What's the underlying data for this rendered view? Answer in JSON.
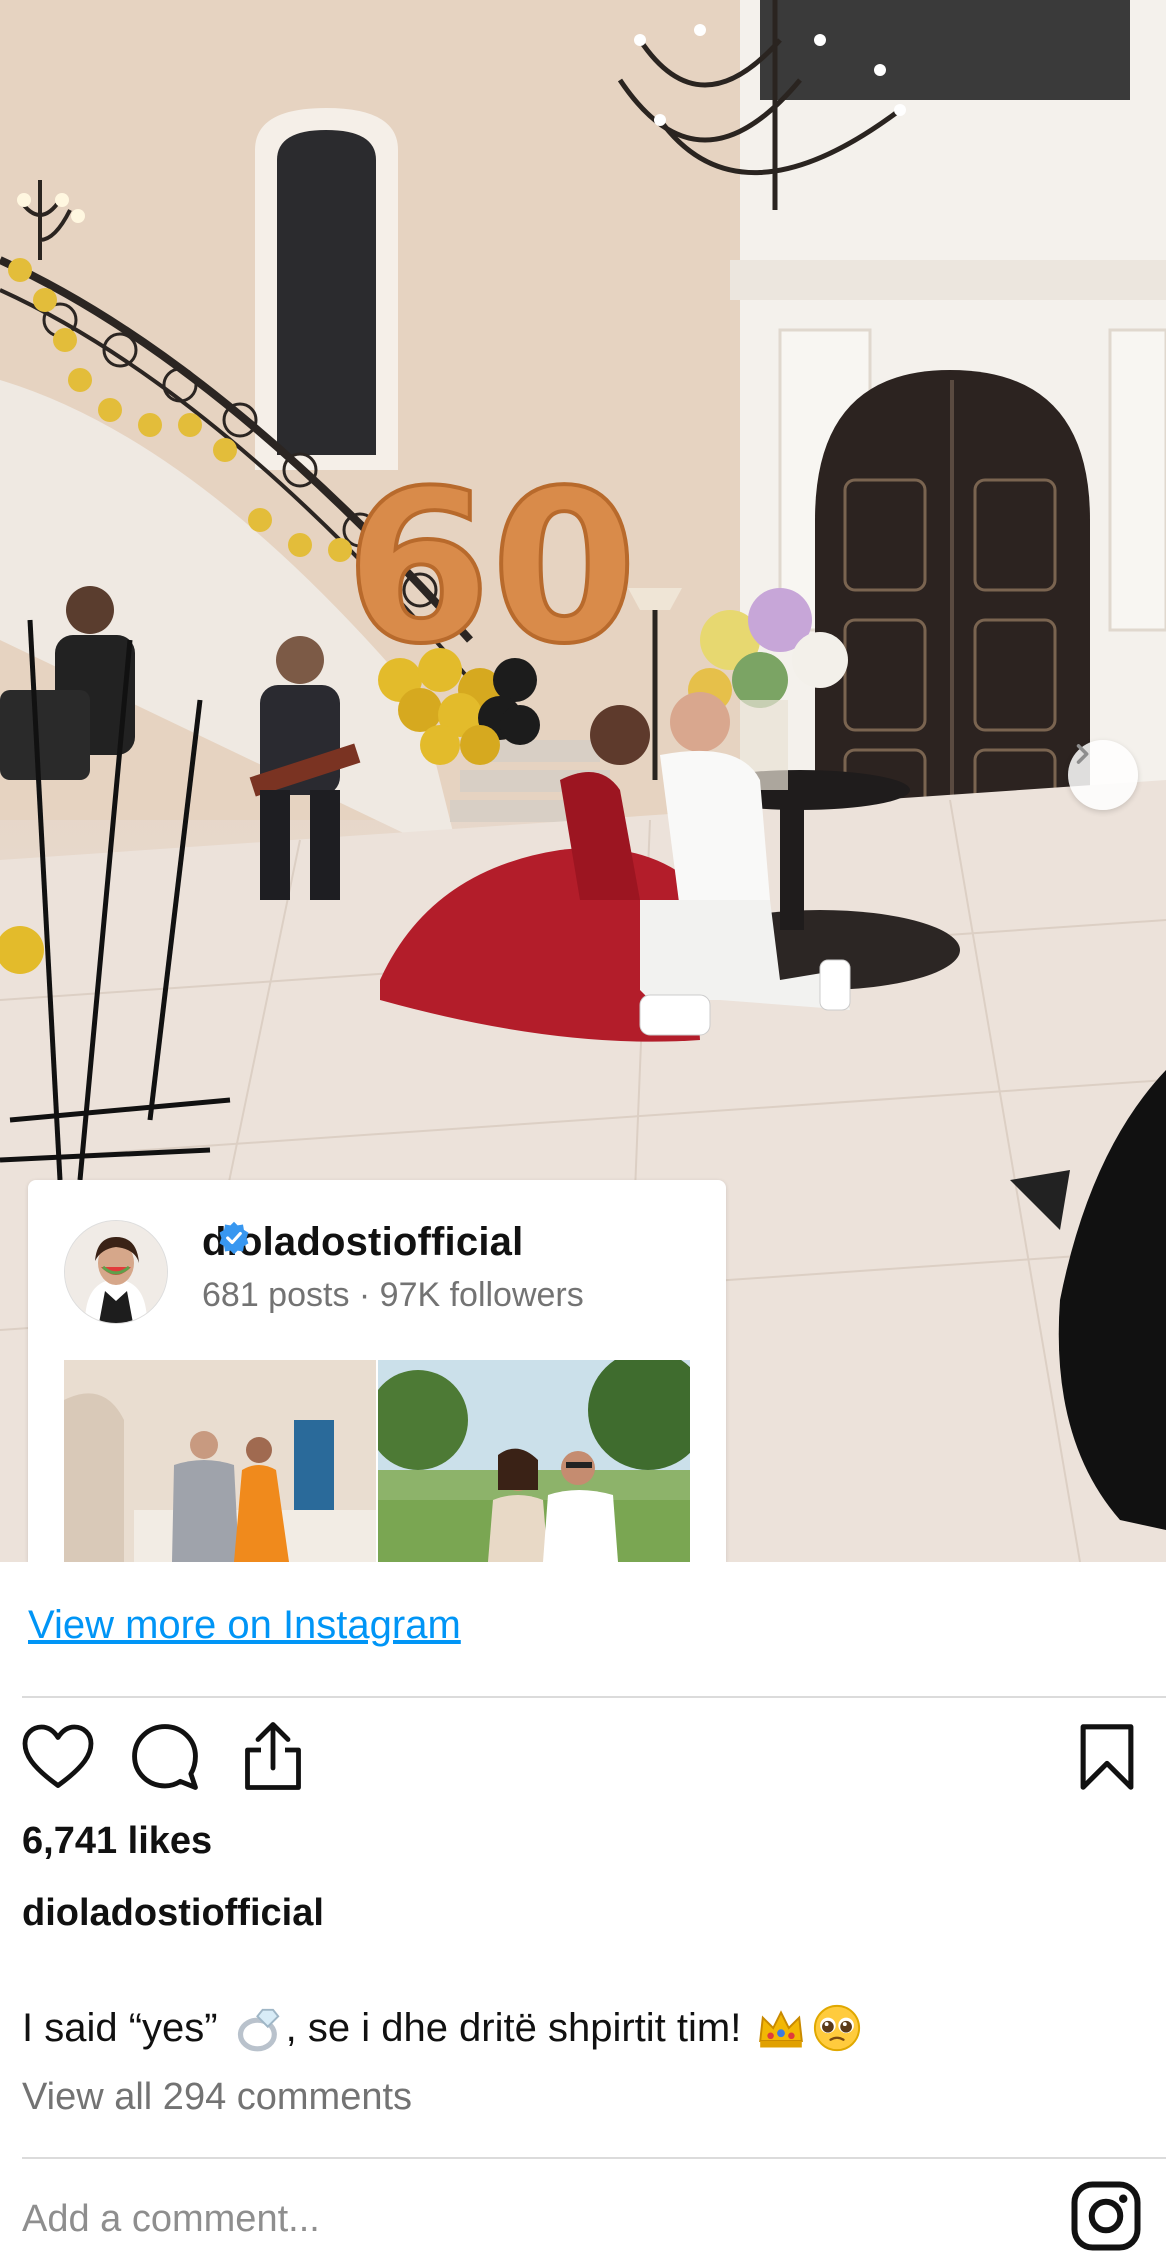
{
  "profile": {
    "username": "dioladostiofficial",
    "stats": "681 posts · 97K followers"
  },
  "links": {
    "view_more": "View more on Instagram"
  },
  "post": {
    "likes": "6,741 likes",
    "username": "dioladostiofficial",
    "caption_part1": "I said “yes”",
    "caption_part2": ", se i dhe dritë shpirtit tim!",
    "view_comments": "View all 294 comments",
    "comment_placeholder": "Add a comment..."
  },
  "photo_balloon_text": "60",
  "colors": {
    "link_blue": "#0095f6",
    "verified_blue": "#3897f0",
    "muted_gray": "#737373",
    "divider": "#dbdbdb"
  },
  "icons": [
    "heart-icon",
    "comment-icon",
    "share-icon",
    "bookmark-icon",
    "instagram-logo-icon",
    "chevron-right-icon",
    "verified-badge-icon",
    "ring-emoji",
    "crown-emoji",
    "pleading-face-emoji"
  ]
}
